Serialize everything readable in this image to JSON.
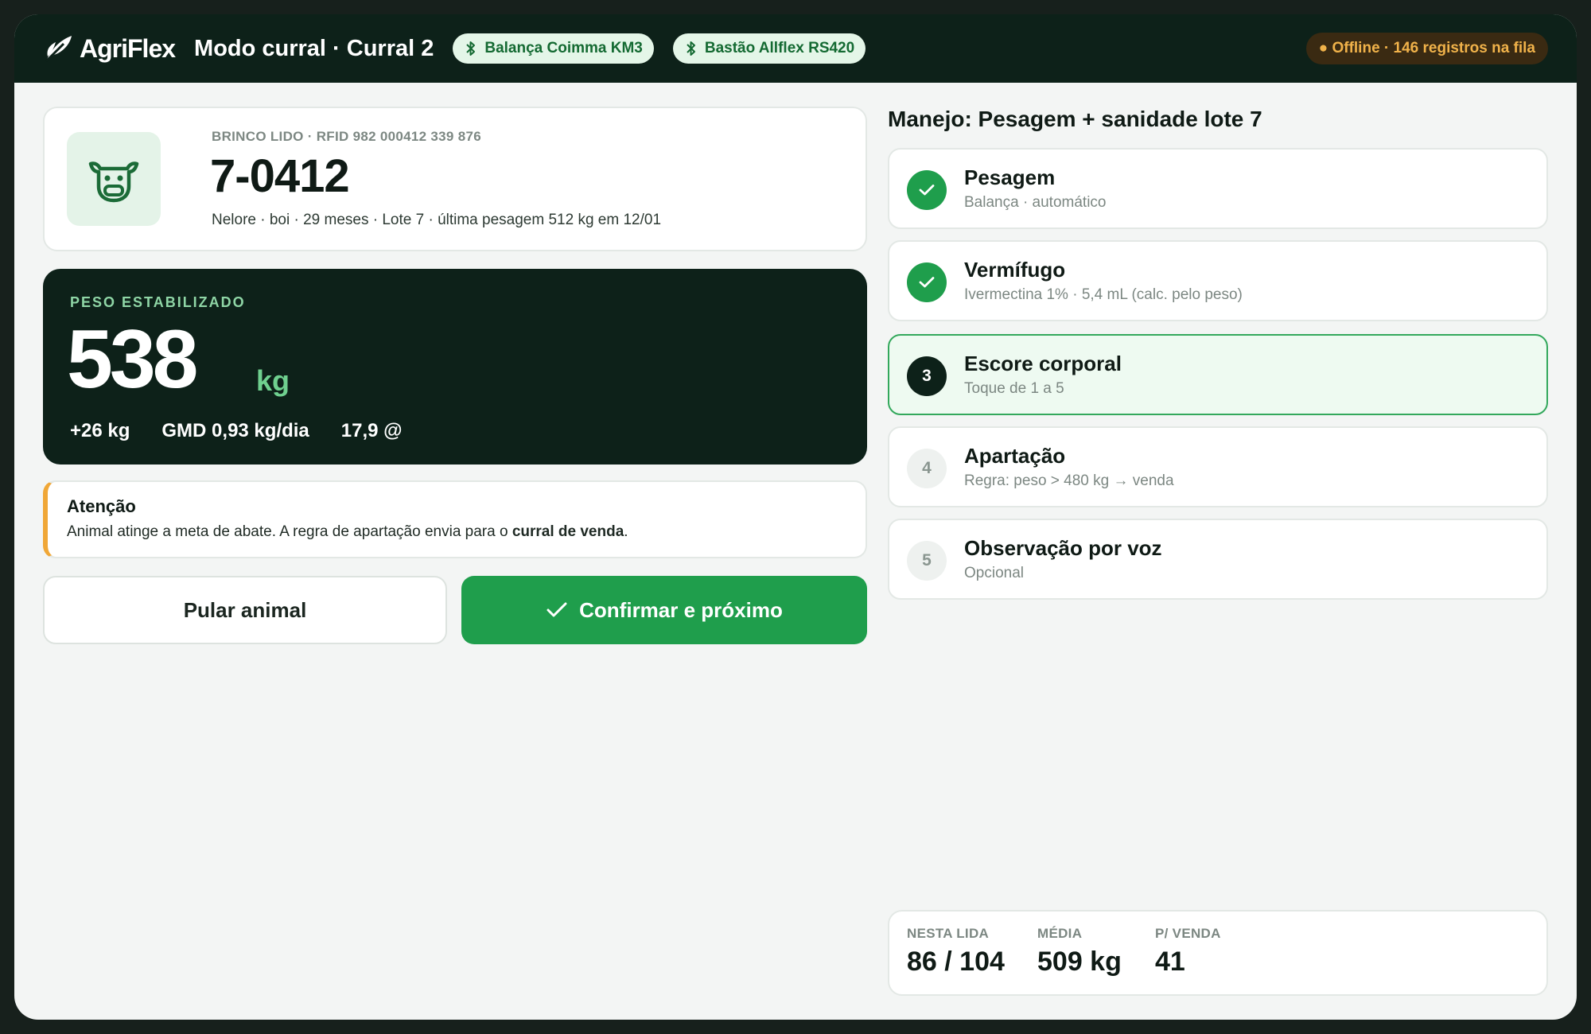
{
  "header": {
    "brand": "AgriFlex",
    "mode_title": "Modo curral · Curral 2",
    "scale_chip": "Balança Coimma KM3",
    "wand_chip": "Bastão Allflex RS420",
    "offline_status": "● Offline · 146 registros na fila"
  },
  "animal": {
    "rfid_label": "BRINCO LIDO · RFID 982 000412 339 876",
    "id": "7-0412",
    "meta": "Nelore · boi · 29 meses · Lote 7 · última pesagem 512 kg em 12/01"
  },
  "weight": {
    "label": "PESO ESTABILIZADO",
    "value": "538",
    "unit": "kg",
    "gain": "+26 kg",
    "gmd": "GMD 0,93 kg/dia",
    "arroba": "17,9 @"
  },
  "alert": {
    "title": "Atenção",
    "text_before": "Animal atinge a meta de abate. A regra de apartação envia para o ",
    "text_bold": "curral de venda",
    "text_after": "."
  },
  "actions": {
    "skip_label": "Pular animal",
    "confirm_label": "Confirmar e próximo"
  },
  "procedure": {
    "title": "Manejo: Pesagem + sanidade lote 7",
    "steps": [
      {
        "number": "1",
        "title": "Pesagem",
        "subtitle": "Balança · automático",
        "status": "done"
      },
      {
        "number": "2",
        "title": "Vermífugo",
        "subtitle": "Ivermectina 1% · 5,4 mL (calc. pelo peso)",
        "status": "done"
      },
      {
        "number": "3",
        "title": "Escore corporal",
        "subtitle": "Toque de 1 a 5",
        "status": "current"
      },
      {
        "number": "4",
        "title": "Apartação",
        "subtitle": "Regra: peso > 480 kg → venda",
        "status": "pending"
      },
      {
        "number": "5",
        "title": "Observação por voz",
        "subtitle": "Opcional",
        "status": "pending"
      }
    ]
  },
  "summary": {
    "processed_label": "NESTA LIDA",
    "processed_value": "86 / 104",
    "avg_label": "MÉDIA",
    "avg_value": "509 kg",
    "sale_label": "P/ VENDA",
    "sale_value": "41"
  },
  "colors": {
    "dark": "#0d2119",
    "accent_green": "#1f9e4c",
    "warning": "#f0a737"
  }
}
